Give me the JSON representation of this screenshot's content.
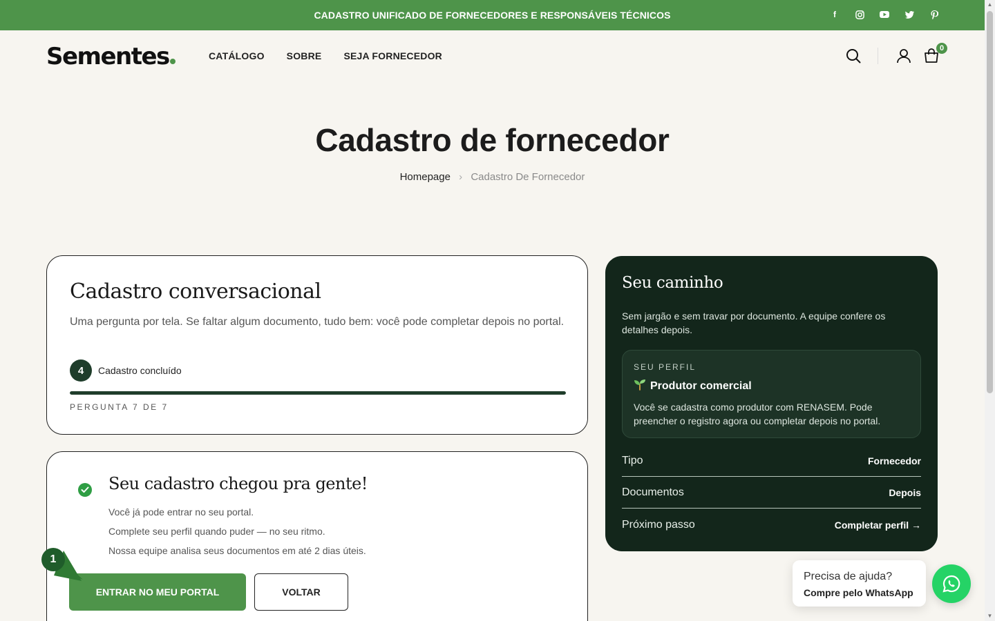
{
  "topbar": {
    "text": "CADASTRO UNIFICADO DE FORNECEDORES E RESPONSÁVEIS TÉCNICOS",
    "social": [
      "facebook-icon",
      "instagram-icon",
      "youtube-icon",
      "twitter-icon",
      "pinterest-icon"
    ]
  },
  "header": {
    "logo": "Sementes",
    "nav": [
      "CATÁLOGO",
      "SOBRE",
      "SEJA FORNECEDOR"
    ],
    "cart_count": "0"
  },
  "hero": {
    "title": "Cadastro de fornecedor",
    "breadcrumb_home": "Homepage",
    "breadcrumb_current": "Cadastro De Fornecedor"
  },
  "form_card": {
    "title": "Cadastro conversacional",
    "subtitle": "Uma pergunta por tela. Se faltar algum documento, tudo bem: você pode completar depois no portal.",
    "step_number": "4",
    "step_label": "Cadastro concluído",
    "question_count": "PERGUNTA 7 DE 7",
    "progress_percent": 100
  },
  "success_card": {
    "title": "Seu cadastro chegou pra gente!",
    "messages": [
      "Você já pode entrar no seu portal.",
      "Complete seu perfil quando puder — no seu ritmo.",
      "Nossa equipe analisa seus documentos em até 2 dias úteis."
    ],
    "primary_button": "ENTRAR NO MEU PORTAL",
    "secondary_button": "VOLTAR"
  },
  "pointer": {
    "number": "1"
  },
  "sidebar": {
    "title": "Seu caminho",
    "intro": "Sem jargão e sem travar por documento. A equipe confere os detalhes depois.",
    "profile_label": "SEU PERFIL",
    "profile_title": "Produtor comercial",
    "profile_desc": "Você se cadastra como produtor com RENASEM. Pode preencher o registro agora ou completar depois no portal.",
    "rows": [
      {
        "key": "Tipo",
        "value": "Fornecedor"
      },
      {
        "key": "Documentos",
        "value": "Depois"
      },
      {
        "key": "Próximo passo",
        "value": "Completar perfil →"
      }
    ]
  },
  "help": {
    "line1": "Precisa de ajuda?",
    "line2": "Compre pelo WhatsApp"
  },
  "colors": {
    "brand_green": "#4e944a",
    "dark_panel": "#13261b",
    "whatsapp": "#25d366"
  }
}
